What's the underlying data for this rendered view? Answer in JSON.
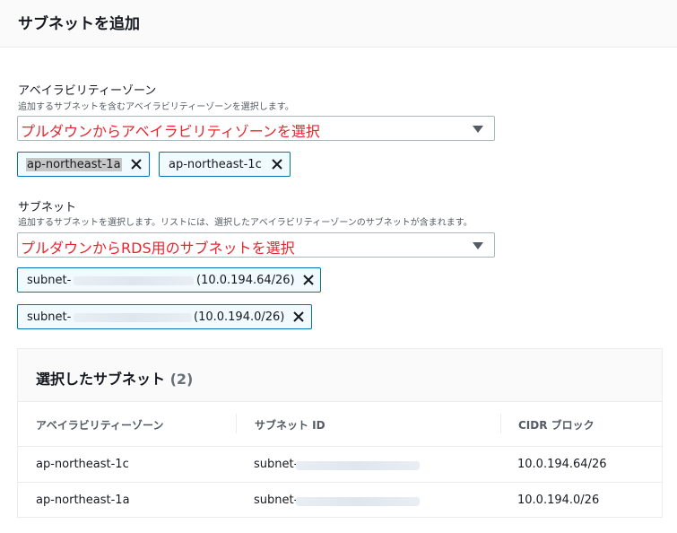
{
  "header": {
    "title": "サブネットを追加"
  },
  "az_field": {
    "label": "アベイラビリティーゾーン",
    "description": "追加するサブネットを含むアベイラビリティーゾーンを選択します。",
    "annotation": "プルダウンからアベイラビリティゾーンを選択",
    "tokens": [
      "ap-northeast-1a",
      "ap-northeast-1c"
    ]
  },
  "subnet_field": {
    "label": "サブネット",
    "description": "追加するサブネットを選択します。リストには、選択したアベイラビリティーゾーンのサブネットが含まれます。",
    "annotation": "プルダウンからRDS用のサブネットを選択",
    "tokens": [
      {
        "prefix": "subnet-",
        "cidr": "(10.0.194.64/26)"
      },
      {
        "prefix": "subnet-",
        "cidr": "(10.0.194.0/26)"
      }
    ]
  },
  "selected_panel": {
    "title": "選択したサブネット",
    "count": "(2)",
    "columns": [
      "アベイラビリティーゾーン",
      "サブネット ID",
      "CIDR ブロック"
    ],
    "rows": [
      {
        "az": "ap-northeast-1c",
        "subnet": "subnet-",
        "cidr": "10.0.194.64/26"
      },
      {
        "az": "ap-northeast-1a",
        "subnet": "subnet-",
        "cidr": "10.0.194.0/26"
      }
    ]
  },
  "colors": {
    "annotation_red": "#e8252e",
    "token_border": "#0073bb"
  },
  "icons": {
    "remove": "close-icon",
    "dropdown": "caret-down-icon"
  }
}
